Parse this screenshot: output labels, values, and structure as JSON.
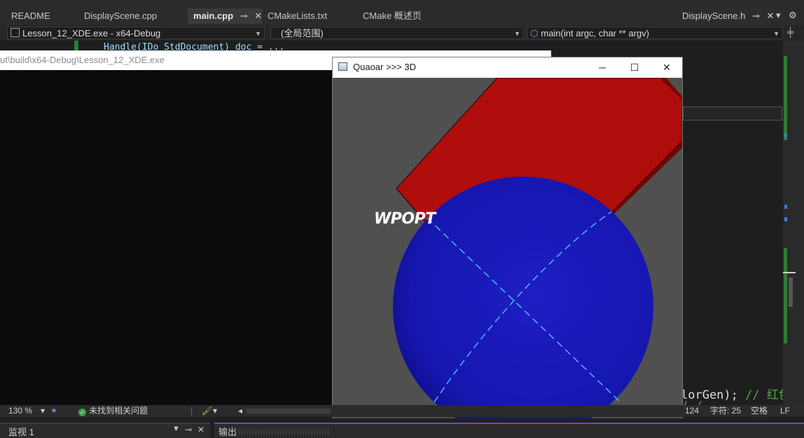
{
  "tabs": {
    "readme": "README",
    "display_cpp": "DisplayScene.cpp",
    "main_cpp": "main.cpp",
    "cmakelists": "CMakeLists.txt",
    "cmake_overview": "CMake 概述页",
    "display_h": "DisplayScene.h"
  },
  "navbar": {
    "project": "Lesson_12_XDE.exe - x64-Debug",
    "scope": "(全局范围)",
    "function": "main(int argc, char ** argv)"
  },
  "editor": {
    "code_fragment": "Handle(IDo_StdDocument) doc = ...",
    "code_line_1_code": "lorGen);",
    "code_line_1_comment": " // 红色",
    "code_line_2": "/ / ... ..."
  },
  "console": {
    "title": "ut\\build\\x64-Debug\\Lesson_12_XDE.exe"
  },
  "window3d": {
    "title": "Quaoar >>> 3D",
    "overlay_label": "WPOPT"
  },
  "statusbar": {
    "zoom": "130 %",
    "issues": "未找到相关问题",
    "line": "124",
    "char": "字符: 25",
    "spaces": "空格",
    "eol": "LF"
  },
  "panels": {
    "watch": "监视 1",
    "output": "输出"
  },
  "colors": {
    "box": "#b00d0d",
    "sphere": "#1a1ab8",
    "curves": "#4fc3f7",
    "viewport": "#505050"
  }
}
